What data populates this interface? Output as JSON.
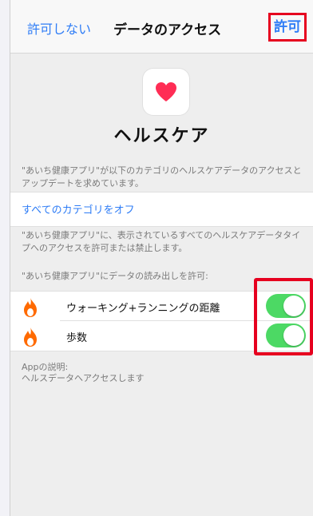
{
  "nav": {
    "left": "許可しない",
    "title": "データのアクセス",
    "right": "許可"
  },
  "app": {
    "name": "ヘルスケア",
    "icon": "heart-icon"
  },
  "texts": {
    "request": "\"あいち健康アプリ\"が以下のカテゴリのヘルスケアデータのアクセスとアップデートを求めています。",
    "all_off": "すべてのカテゴリをオフ",
    "notice": "\"あいち健康アプリ\"に、表示されているすべてのヘルスケアデータタイプへのアクセスを許可または禁止します。",
    "read_header": "\"あいち健康アプリ\"にデータの読み出しを許可:",
    "app_desc_label": "Appの説明:",
    "app_desc": "ヘルスデータへアクセスします"
  },
  "categories": [
    {
      "label": "ウォーキング+ランニングの距離",
      "icon": "flame-icon",
      "enabled": true
    },
    {
      "label": "歩数",
      "icon": "flame-icon",
      "enabled": true
    }
  ],
  "colors": {
    "accent": "#2f7df6",
    "toggle_on": "#4cd964",
    "flame": "#ff6a00",
    "heart": "#ff2d55",
    "highlight": "#e6001f"
  }
}
